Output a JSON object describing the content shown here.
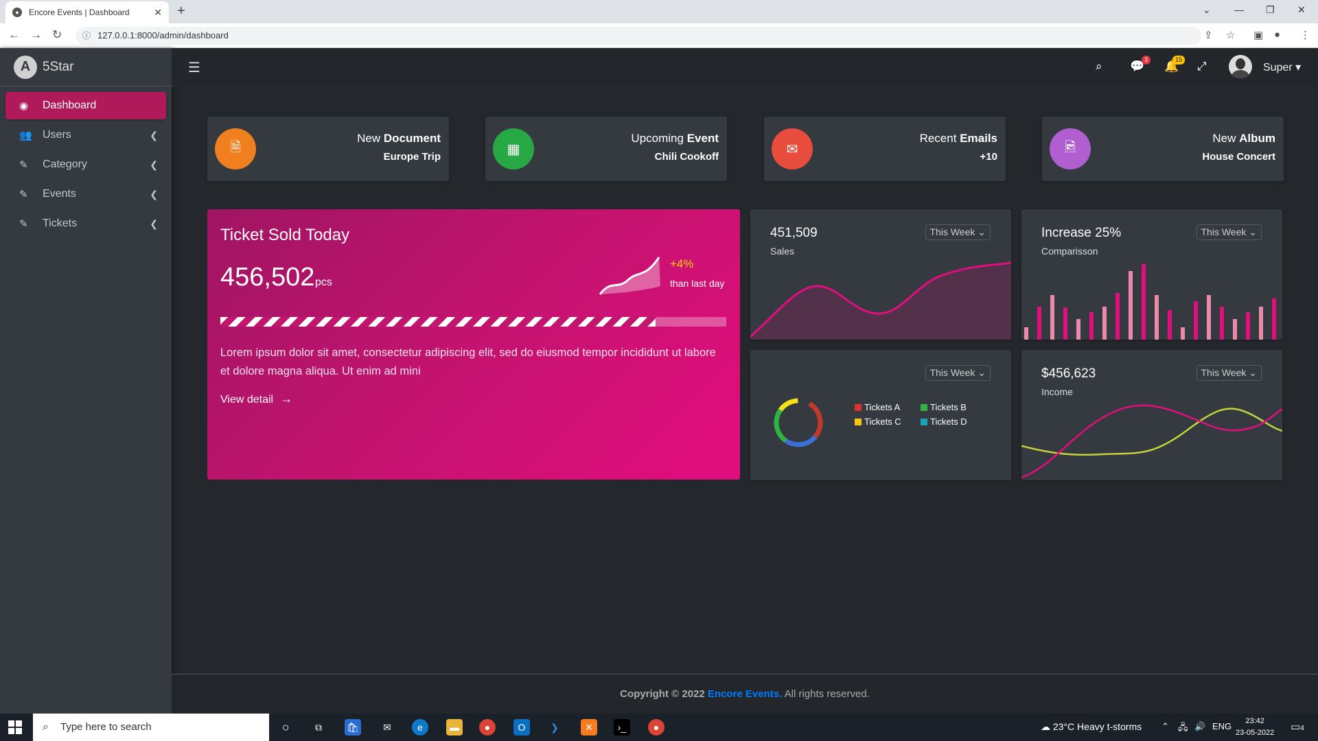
{
  "browser": {
    "tab_title": "Encore Events | Dashboard",
    "url": "127.0.0.1:8000/admin/dashboard"
  },
  "sidebar": {
    "brand": "5Star",
    "items": [
      {
        "label": "Dashboard",
        "icon": "palette-icon",
        "active": true
      },
      {
        "label": "Users",
        "icon": "users-icon"
      },
      {
        "label": "Category",
        "icon": "edit-icon"
      },
      {
        "label": "Events",
        "icon": "edit-icon"
      },
      {
        "label": "Tickets",
        "icon": "edit-icon"
      }
    ]
  },
  "topnav": {
    "messages_badge": "3",
    "notifications_badge": "15",
    "user_name": "Super"
  },
  "info_boxes": [
    {
      "prefix": "New",
      "bold": "Document",
      "sub": "Europe Trip",
      "color": "#fd7e14",
      "icon": "document-icon"
    },
    {
      "prefix": "Upcoming",
      "bold": "Event",
      "sub": "Chili Cookoff",
      "color": "#28a745",
      "icon": "calendar-icon"
    },
    {
      "prefix": "Recent",
      "bold": "Emails",
      "sub": "+10",
      "color": "#e74c3c",
      "icon": "envelope-icon"
    },
    {
      "prefix": "New",
      "bold": "Album",
      "sub": "House Concert",
      "color": "#b15fd0",
      "icon": "image-file-icon"
    }
  ],
  "ticket_card": {
    "title": "Ticket Sold Today",
    "value": "456,502",
    "unit": "pcs",
    "change": "+4%",
    "change_label": "than last day",
    "progress": 0.86,
    "text": "Lorem ipsum dolor sit amet, consectetur adipiscing elit, sed do eiusmod tempor incididunt ut labore et dolore magna aliqua. Ut enim ad mini",
    "link": "View detail"
  },
  "cards": {
    "sales": {
      "value": "451,509",
      "label": "Sales",
      "period": "This Week"
    },
    "comparison": {
      "value": "Increase 25%",
      "label": "Comparisson",
      "period": "This Week"
    },
    "tickets": {
      "period": "This Week",
      "legend": [
        "Tickets A",
        "Tickets B",
        "Tickets C",
        "Tickets D"
      ],
      "colors": [
        "#e03131",
        "#2fb344",
        "#f5c518",
        "#17a2b8"
      ]
    },
    "income": {
      "value": "$456,623",
      "label": "Income",
      "period": "This Week"
    }
  },
  "footer": {
    "copyright": "Copyright © 2022",
    "brand": "Encore Events.",
    "rights": "All rights reserved."
  },
  "taskbar": {
    "search_placeholder": "Type here to search",
    "weather": "23°C  Heavy t-storms",
    "lang": "ENG",
    "time": "23:42",
    "date": "23-05-2022",
    "notifications": "4"
  }
}
